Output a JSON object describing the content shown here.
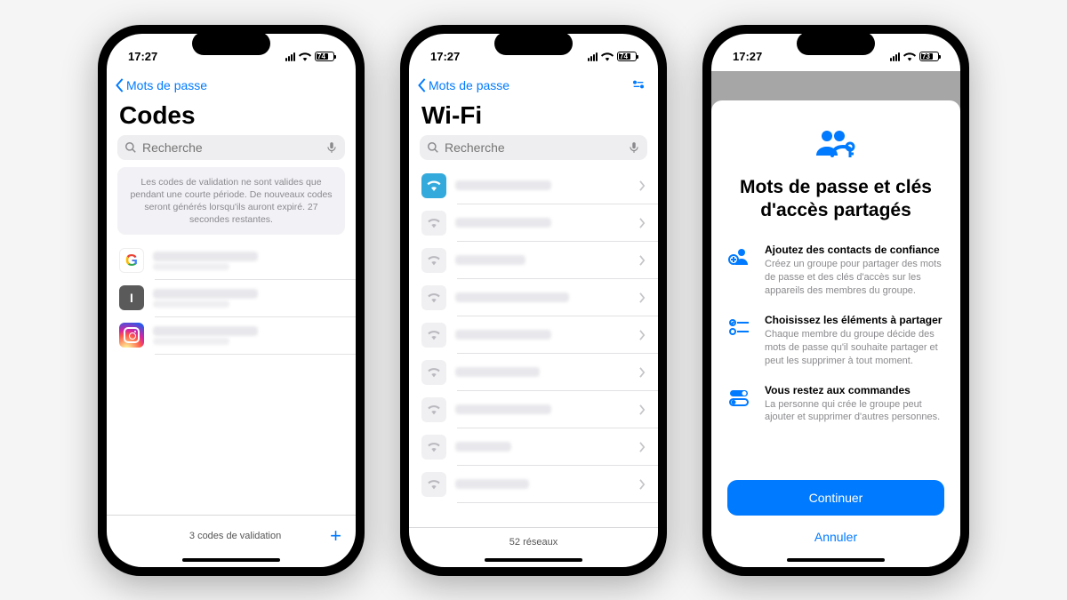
{
  "status": {
    "time": "17:27",
    "battery1": "74",
    "battery2": "74",
    "battery3": "73"
  },
  "phone1": {
    "back_label": "Mots de passe",
    "title": "Codes",
    "search_placeholder": "Recherche",
    "info_text": "Les codes de validation ne sont valides que pendant une courte période. De nouveaux codes seront générés lorsqu'ils auront expiré. 27 secondes restantes.",
    "footer_text": "3 codes de validation"
  },
  "phone2": {
    "back_label": "Mots de passe",
    "title": "Wi-Fi",
    "search_placeholder": "Recherche",
    "footer_text": "52 réseaux"
  },
  "phone3": {
    "title": "Mots de passe et clés d'accès partagés",
    "features": [
      {
        "heading": "Ajoutez des contacts de confiance",
        "body": "Créez un groupe pour partager des mots de passe et des clés d'accès sur les appareils des membres du groupe."
      },
      {
        "heading": "Choisissez les éléments à partager",
        "body": "Chaque membre du groupe décide des mots de passe qu'il souhaite partager et peut les supprimer à tout moment."
      },
      {
        "heading": "Vous restez aux commandes",
        "body": "La personne qui crée le groupe peut ajouter et supprimer d'autres personnes."
      }
    ],
    "continue_label": "Continuer",
    "cancel_label": "Annuler"
  }
}
